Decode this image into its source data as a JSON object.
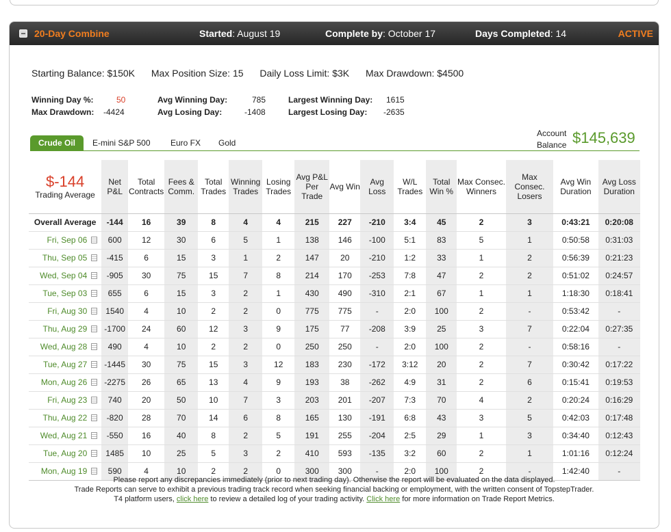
{
  "header": {
    "title": "20-Day Combine",
    "started_label": "Started",
    "started_value": "August 19",
    "complete_label": "Complete by",
    "complete_value": "October 17",
    "days_label": "Days Completed",
    "days_value": "14",
    "status": "ACTIVE",
    "collapse_glyph": "−"
  },
  "rules": {
    "starting_balance": "Starting Balance: $150K",
    "max_position": "Max Position Size: 15",
    "daily_loss": "Daily Loss Limit: $3K",
    "max_drawdown": "Max Drawdown: $4500"
  },
  "stats": {
    "winning_day_pct_label": "Winning Day %:",
    "winning_day_pct": "50",
    "max_drawdown_label": "Max Drawdown:",
    "max_drawdown": "-4424",
    "avg_winning_day_label": "Avg Winning Day:",
    "avg_winning_day": "785",
    "avg_losing_day_label": "Avg Losing Day:",
    "avg_losing_day": "-1408",
    "largest_winning_day_label": "Largest Winning Day:",
    "largest_winning_day": "1615",
    "largest_losing_day_label": "Largest Losing Day:",
    "largest_losing_day": "-2635"
  },
  "tabs": [
    "Crude Oil",
    "E-mini S&P 500",
    "Euro FX",
    "Gold"
  ],
  "account": {
    "label_line1": "Account",
    "label_line2": "Balance",
    "value": "$145,639"
  },
  "summary": {
    "trading_average_value": "$-144",
    "trading_average_label": "Trading Average"
  },
  "columns": [
    "Net P&L",
    "Total Contracts",
    "Fees & Comm.",
    "Total Trades",
    "Winning Trades",
    "Losing Trades",
    "Avg P&L Per Trade",
    "Avg Win",
    "Avg Loss",
    "W/L Trades",
    "Total Win %",
    "Max Consec. Winners",
    "Max Consec. Losers",
    "Avg Win Duration",
    "Avg Loss Duration"
  ],
  "overall": {
    "label": "Overall Average",
    "cells": [
      "-144",
      "16",
      "39",
      "8",
      "4",
      "4",
      "215",
      "227",
      "-210",
      "3:4",
      "45",
      "2",
      "3",
      "0:43:21",
      "0:20:08"
    ]
  },
  "rows": [
    {
      "date": "Fri, Sep 06",
      "cells": [
        "600",
        "12",
        "30",
        "6",
        "5",
        "1",
        "138",
        "146",
        "-100",
        "5:1",
        "83",
        "5",
        "1",
        "0:50:58",
        "0:31:03"
      ]
    },
    {
      "date": "Thu, Sep 05",
      "cells": [
        "-415",
        "6",
        "15",
        "3",
        "1",
        "2",
        "147",
        "20",
        "-210",
        "1:2",
        "33",
        "1",
        "2",
        "0:56:39",
        "0:21:23"
      ]
    },
    {
      "date": "Wed, Sep 04",
      "cells": [
        "-905",
        "30",
        "75",
        "15",
        "7",
        "8",
        "214",
        "170",
        "-253",
        "7:8",
        "47",
        "2",
        "2",
        "0:51:02",
        "0:24:57"
      ]
    },
    {
      "date": "Tue, Sep 03",
      "cells": [
        "655",
        "6",
        "15",
        "3",
        "2",
        "1",
        "430",
        "490",
        "-310",
        "2:1",
        "67",
        "1",
        "1",
        "1:18:30",
        "0:18:41"
      ]
    },
    {
      "date": "Fri, Aug 30",
      "cells": [
        "1540",
        "4",
        "10",
        "2",
        "2",
        "0",
        "775",
        "775",
        "-",
        "2:0",
        "100",
        "2",
        "-",
        "0:53:42",
        "-"
      ]
    },
    {
      "date": "Thu, Aug 29",
      "cells": [
        "-1700",
        "24",
        "60",
        "12",
        "3",
        "9",
        "175",
        "77",
        "-208",
        "3:9",
        "25",
        "3",
        "7",
        "0:22:04",
        "0:27:35"
      ]
    },
    {
      "date": "Wed, Aug 28",
      "cells": [
        "490",
        "4",
        "10",
        "2",
        "2",
        "0",
        "250",
        "250",
        "-",
        "2:0",
        "100",
        "2",
        "-",
        "0:58:16",
        "-"
      ]
    },
    {
      "date": "Tue, Aug 27",
      "cells": [
        "-1445",
        "30",
        "75",
        "15",
        "3",
        "12",
        "183",
        "230",
        "-172",
        "3:12",
        "20",
        "2",
        "7",
        "0:30:42",
        "0:17:22"
      ]
    },
    {
      "date": "Mon, Aug 26",
      "cells": [
        "-2275",
        "26",
        "65",
        "13",
        "4",
        "9",
        "193",
        "38",
        "-262",
        "4:9",
        "31",
        "2",
        "6",
        "0:15:41",
        "0:19:53"
      ]
    },
    {
      "date": "Fri, Aug 23",
      "cells": [
        "740",
        "20",
        "50",
        "10",
        "7",
        "3",
        "203",
        "201",
        "-207",
        "7:3",
        "70",
        "4",
        "2",
        "0:20:24",
        "0:16:29"
      ]
    },
    {
      "date": "Thu, Aug 22",
      "cells": [
        "-820",
        "28",
        "70",
        "14",
        "6",
        "8",
        "165",
        "130",
        "-191",
        "6:8",
        "43",
        "3",
        "5",
        "0:42:03",
        "0:17:48"
      ]
    },
    {
      "date": "Wed, Aug 21",
      "cells": [
        "-550",
        "16",
        "40",
        "8",
        "2",
        "5",
        "191",
        "255",
        "-204",
        "2:5",
        "29",
        "1",
        "3",
        "0:34:40",
        "0:12:43"
      ]
    },
    {
      "date": "Tue, Aug 20",
      "cells": [
        "1485",
        "10",
        "25",
        "5",
        "3",
        "2",
        "410",
        "593",
        "-135",
        "3:2",
        "60",
        "2",
        "1",
        "1:01:16",
        "0:12:24"
      ]
    },
    {
      "date": "Mon, Aug 19",
      "cells": [
        "590",
        "4",
        "10",
        "2",
        "2",
        "0",
        "300",
        "300",
        "-",
        "2:0",
        "100",
        "2",
        "-",
        "1:42:40",
        "-"
      ]
    }
  ],
  "footer": {
    "line1": "Please report any discrepancies immediately (prior to next trading day). Otherwise the report will be evaluated on the data displayed.",
    "line2": "Trade Reports can serve to exhibit a previous trading track record when seeking financial backing or employment, with the written consent of TopstepTrader.",
    "line3_a": "T4 platform users, ",
    "link1": "click here",
    "line3_b": " to review a detailed log of your trading activity. ",
    "link2": "Click here",
    "line3_c": " for more information on Trade Report Metrics."
  },
  "colors": {
    "accent_orange": "#f07d1f",
    "green": "#5a9a2c",
    "negative_red": "#d9402a"
  }
}
